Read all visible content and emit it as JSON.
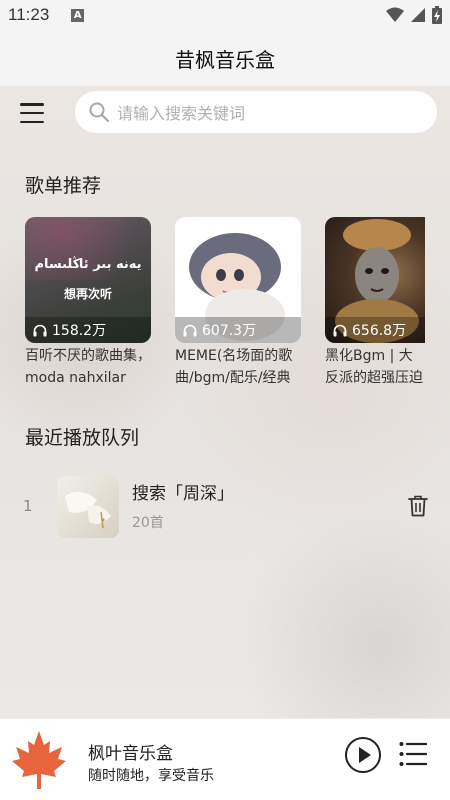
{
  "status": {
    "time": "11:23",
    "notification_badge": "A"
  },
  "app": {
    "title": "昔枫音乐盒"
  },
  "search": {
    "placeholder": "请输入搜索关键词"
  },
  "recommend": {
    "title": "歌单推荐",
    "playlists": [
      {
        "name": "百听不厌的歌曲集，moda nahxilar",
        "plays": "158.2万",
        "cover_text_top": "يەنە بىر ئاڭلىسام",
        "cover_text_bottom": "想再次听"
      },
      {
        "name": "MEME(名场面的歌曲/bgm/配乐/经典",
        "plays": "607.3万"
      },
      {
        "name": "黑化Bgm | 大反派的超强压迫感",
        "plays": "656.8万"
      }
    ]
  },
  "queue": {
    "title": "最近播放队列",
    "items": [
      {
        "index": "1",
        "title": "搜索「周深」",
        "count": "20首"
      }
    ]
  },
  "player": {
    "title": "枫叶音乐盒",
    "subtitle": "随时随地，享受音乐"
  },
  "colors": {
    "leaf": "#e8643c",
    "accent_bg": "#f4f4f4"
  }
}
